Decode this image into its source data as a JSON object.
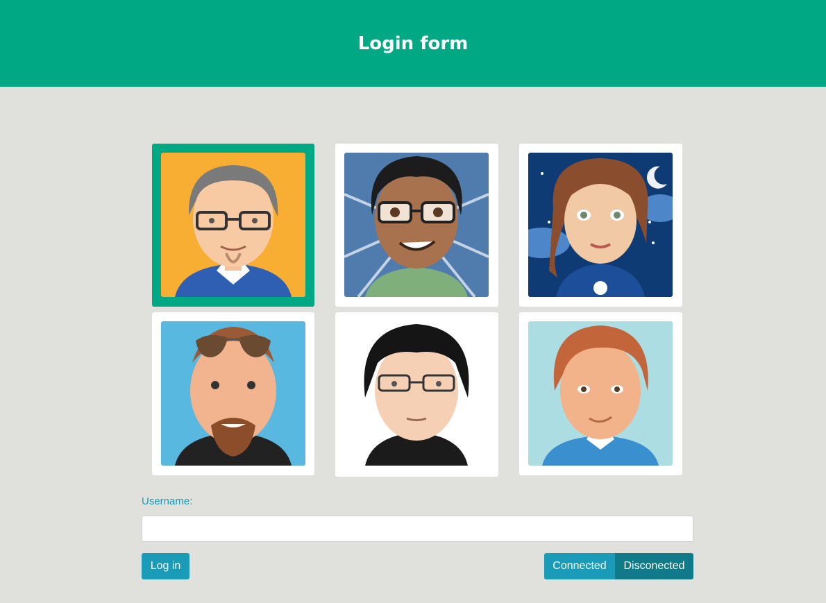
{
  "header": {
    "title": "Login form"
  },
  "avatars": [
    {
      "name": "avatar-gray-hair-glasses",
      "bg": "#f7ae33",
      "selected": true
    },
    {
      "name": "avatar-dark-hair-glasses",
      "bg": "#4f7cad",
      "selected": false
    },
    {
      "name": "avatar-brown-hair-woman",
      "bg": "#0f3b75",
      "selected": false
    },
    {
      "name": "avatar-sunglasses-beard",
      "bg": "#58b8e0",
      "selected": false
    },
    {
      "name": "avatar-black-hair-glasses",
      "bg": "#ffffff",
      "selected": false
    },
    {
      "name": "avatar-red-hair",
      "bg": "#abdde2",
      "selected": false
    }
  ],
  "form": {
    "username_label": "Username:",
    "username_value": "",
    "login_label": "Log in"
  },
  "status_toggle": {
    "connected_label": "Connected",
    "disconnected_label": "Disconected",
    "active": "Disconected"
  },
  "colors": {
    "header_bg": "#00a884",
    "page_bg": "#e0e0dc",
    "accent": "#1a9cb8",
    "accent_dark": "#117a8a"
  }
}
